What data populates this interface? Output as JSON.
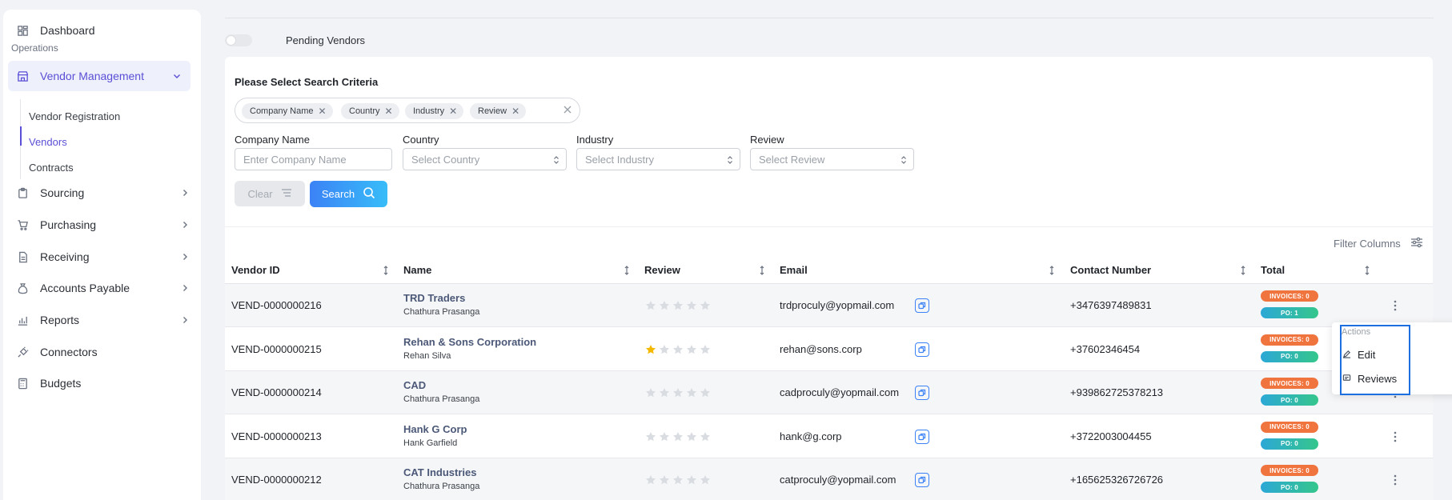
{
  "sidebar": {
    "dashboard": "Dashboard",
    "section": "Operations",
    "vendor_management": "Vendor Management",
    "sub_items": [
      "Vendor Registration",
      "Vendors",
      "Contracts"
    ],
    "items": [
      "Sourcing",
      "Purchasing",
      "Receiving",
      "Accounts Payable",
      "Reports",
      "Connectors",
      "Budgets"
    ]
  },
  "pending": {
    "label": "Pending Vendors",
    "enabled": false
  },
  "search": {
    "title": "Please Select Search Criteria",
    "chips": [
      "Company Name",
      "Country",
      "Industry",
      "Review"
    ],
    "fields": [
      {
        "label": "Company Name",
        "placeholder": "Enter Company Name"
      },
      {
        "label": "Country",
        "placeholder": "Select Country"
      },
      {
        "label": "Industry",
        "placeholder": "Select Industry"
      },
      {
        "label": "Review",
        "placeholder": "Select Review"
      }
    ],
    "clear_label": "Clear",
    "search_label": "Search"
  },
  "table": {
    "filter_columns": "Filter Columns",
    "headers": [
      "Vendor ID",
      "Name",
      "Review",
      "Email",
      "Contact Number",
      "Total"
    ],
    "rows": [
      {
        "id": "VEND-0000000216",
        "name": "TRD Traders",
        "contact": "Chathura Prasanga",
        "rating": 0,
        "email": "trdproculy@yopmail.com",
        "phone": "+3476397489831",
        "invoices": "INVOICES: 0",
        "po": "PO: 1"
      },
      {
        "id": "VEND-0000000215",
        "name": "Rehan & Sons Corporation",
        "contact": "Rehan Silva",
        "rating": 1,
        "email": "rehan@sons.corp",
        "phone": "+37602346454",
        "invoices": "INVOICES: 0",
        "po": "PO: 0"
      },
      {
        "id": "VEND-0000000214",
        "name": "CAD",
        "contact": "Chathura Prasanga",
        "rating": 0,
        "email": "cadproculy@yopmail.com",
        "phone": "+939862725378213",
        "invoices": "INVOICES: 0",
        "po": "PO: 0"
      },
      {
        "id": "VEND-0000000213",
        "name": "Hank G Corp",
        "contact": "Hank Garfield",
        "rating": 0,
        "email": "hank@g.corp",
        "phone": "+3722003004455",
        "invoices": "INVOICES: 0",
        "po": "PO: 0"
      },
      {
        "id": "VEND-0000000212",
        "name": "CAT Industries",
        "contact": "Chathura Prasanga",
        "rating": 0,
        "email": "catproculy@yopmail.com",
        "phone": "+165625326726726",
        "invoices": "INVOICES: 0",
        "po": "PO: 0"
      }
    ]
  },
  "actions_menu": {
    "title": "Actions",
    "items": [
      "Edit",
      "Reviews"
    ]
  },
  "colors": {
    "accent": "#5a4fd6",
    "primary": "#3b82f6",
    "invoice_badge": "#f0743e",
    "po_badge": "#35c68c",
    "star_filled": "#f5b800",
    "star_empty": "#d9dce1"
  }
}
